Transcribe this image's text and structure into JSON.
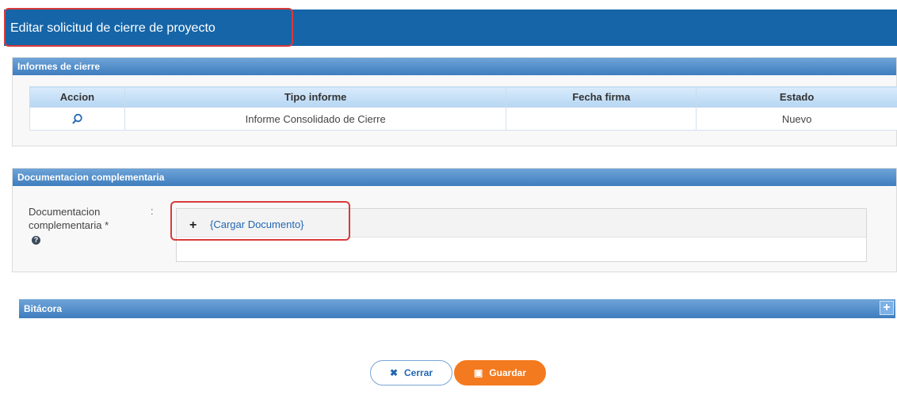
{
  "header": {
    "title": "Editar solicitud de cierre de proyecto"
  },
  "informes": {
    "panel_title": "Informes de cierre",
    "columns": [
      "Accion",
      "Tipo informe",
      "Fecha firma",
      "Estado"
    ],
    "rows": [
      {
        "accion_icon": "search-icon",
        "tipo": "Informe Consolidado de Cierre",
        "fecha": "",
        "estado": "Nuevo"
      }
    ]
  },
  "documentacion": {
    "panel_title": "Documentacion complementaria",
    "field_label": "Documentacion complementaria *",
    "colon": ":",
    "help_icon": "question-icon",
    "upload_label": "{Cargar Documento}"
  },
  "bitacora": {
    "title": "Bitácora",
    "expand_icon": "plus-icon"
  },
  "buttons": {
    "close_label": "Cerrar",
    "save_label": "Guardar"
  },
  "colors": {
    "header": "#1565a8",
    "panel_header": "#3e7dbe",
    "save": "#f47a1f",
    "annotation": "#d93a3a"
  }
}
